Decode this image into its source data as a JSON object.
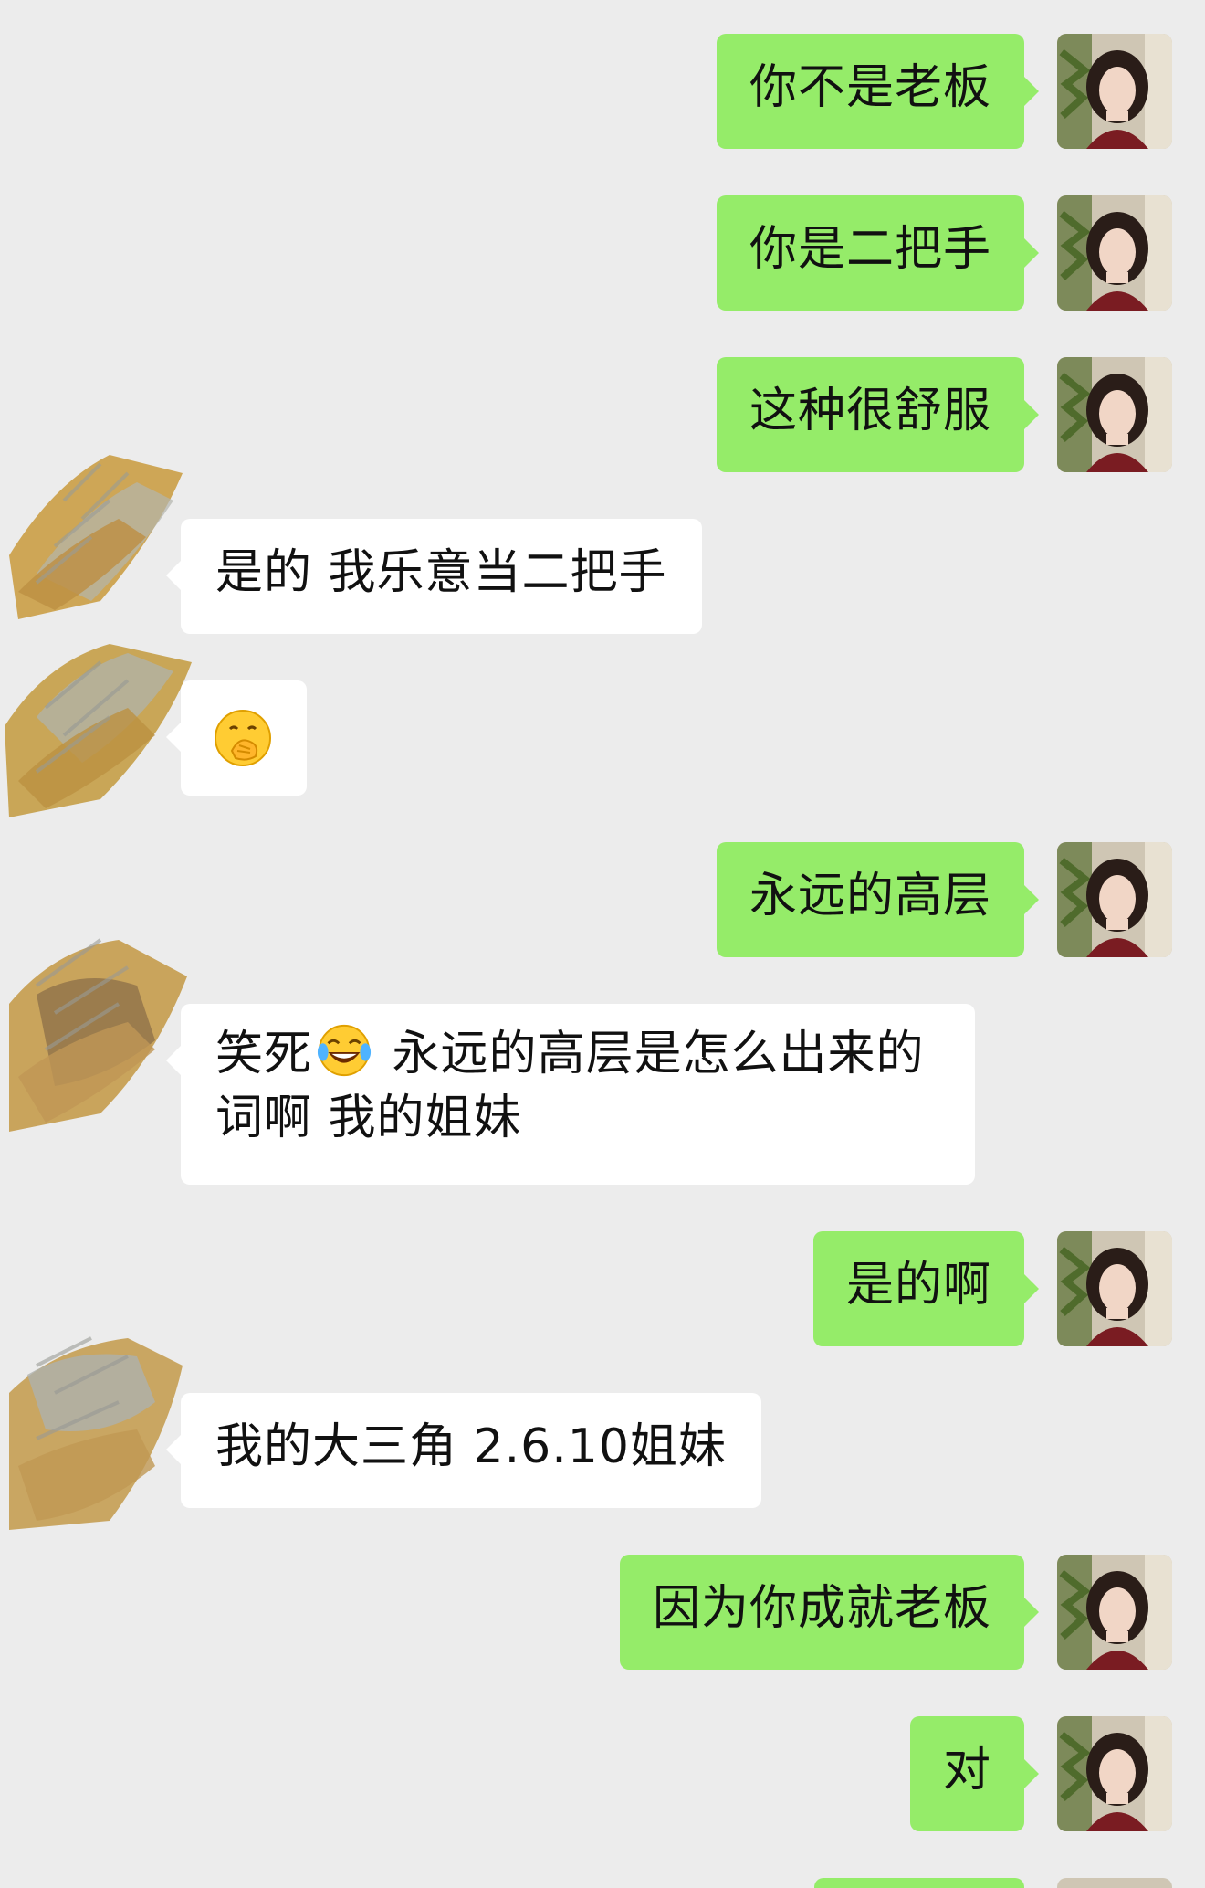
{
  "conversation": {
    "messages": [
      {
        "side": "out",
        "text": "你不是老板"
      },
      {
        "side": "out",
        "text": "你是二把手"
      },
      {
        "side": "out",
        "text": "这种很舒服"
      },
      {
        "side": "in",
        "text": "是的 我乐意当二把手"
      },
      {
        "side": "in",
        "emoji": "face-with-hand-over-mouth-emoji"
      },
      {
        "side": "out",
        "text": "永远的高层"
      },
      {
        "side": "in",
        "text_before": "笑死",
        "emoji": "tears-of-joy-emoji",
        "text_after": " 永远的高层是怎么出来的词啊 我的姐妹"
      },
      {
        "side": "out",
        "text": "是的啊"
      },
      {
        "side": "in",
        "text": "我的大三角 2.6.10姐妹"
      },
      {
        "side": "out",
        "text": "因为你成就老板"
      },
      {
        "side": "out",
        "text": "对"
      }
    ]
  },
  "colors": {
    "background": "#ececec",
    "outgoing_bubble": "#95ec69",
    "incoming_bubble": "#ffffff",
    "text": "#111111"
  }
}
